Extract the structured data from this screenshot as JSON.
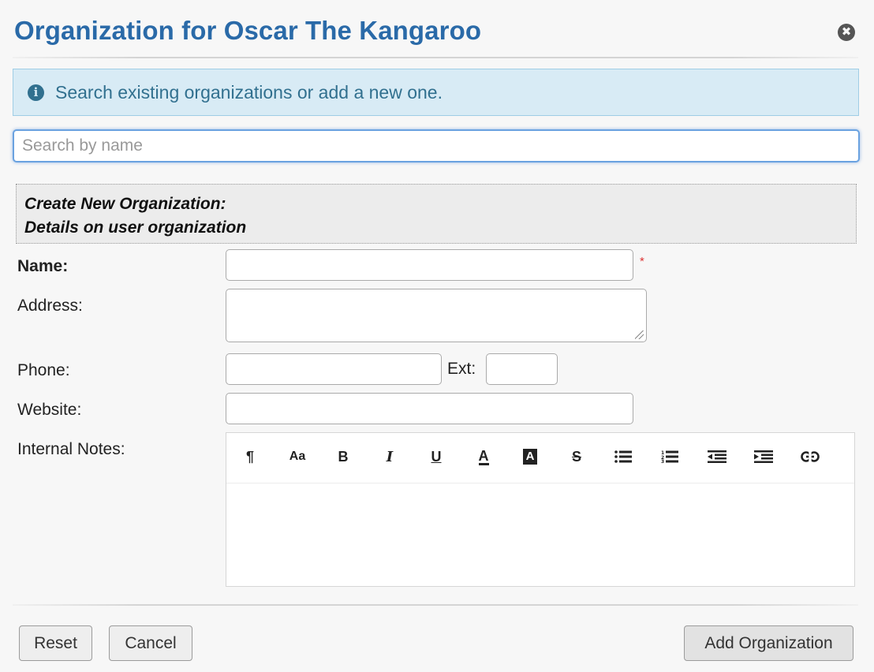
{
  "dialog": {
    "title": "Organization for Oscar The Kangaroo",
    "close_glyph": "✖"
  },
  "info": {
    "icon": "info-circle-icon",
    "text": "Search existing organizations or add a new one."
  },
  "search": {
    "placeholder": "Search by name",
    "value": ""
  },
  "section": {
    "line1": "Create New Organization:",
    "line2": "Details on user organization"
  },
  "form": {
    "name_label": "Name:",
    "name_required_mark": "*",
    "address_label": "Address:",
    "phone_label": "Phone:",
    "ext_label": "Ext:",
    "website_label": "Website:",
    "notes_label": "Internal Notes:"
  },
  "toolbar": {
    "paragraph": "¶",
    "font": "Aa",
    "bold": "B",
    "italic": "I",
    "underline": "U",
    "font_color": "A",
    "highlight": "A",
    "strike": "S",
    "icons": [
      "paragraph-icon",
      "font-size-icon",
      "bold-icon",
      "italic-icon",
      "underline-icon",
      "font-color-icon",
      "highlight-icon",
      "strikethrough-icon",
      "bullet-list-icon",
      "numbered-list-icon",
      "outdent-icon",
      "indent-icon",
      "link-icon"
    ]
  },
  "buttons": {
    "reset": "Reset",
    "cancel": "Cancel",
    "add": "Add Organization"
  },
  "colors": {
    "title": "#2a6aa8",
    "info_bg": "#d8ebf5",
    "info_text": "#31708f",
    "required": "#dd3333",
    "focus_border": "#6aa2e0"
  }
}
